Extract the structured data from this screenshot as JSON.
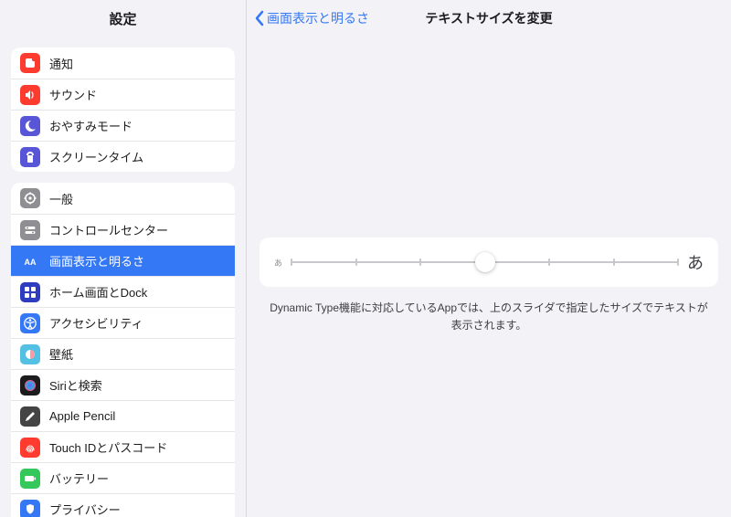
{
  "sidebar": {
    "title": "設定",
    "groups": [
      {
        "items": [
          {
            "key": "notifications",
            "label": "通知"
          },
          {
            "key": "sounds",
            "label": "サウンド"
          },
          {
            "key": "dnd",
            "label": "おやすみモード"
          },
          {
            "key": "screentime",
            "label": "スクリーンタイム"
          }
        ]
      },
      {
        "items": [
          {
            "key": "general",
            "label": "一般"
          },
          {
            "key": "controlcenter",
            "label": "コントロールセンター"
          },
          {
            "key": "display",
            "label": "画面表示と明るさ",
            "selected": true
          },
          {
            "key": "homescreen",
            "label": "ホーム画面とDock"
          },
          {
            "key": "accessibility",
            "label": "アクセシビリティ"
          },
          {
            "key": "wallpaper",
            "label": "壁紙"
          },
          {
            "key": "siri",
            "label": "Siriと検索"
          },
          {
            "key": "pencil",
            "label": "Apple Pencil"
          },
          {
            "key": "touchid",
            "label": "Touch IDとパスコード"
          },
          {
            "key": "battery",
            "label": "バッテリー"
          },
          {
            "key": "privacy",
            "label": "プライバシー"
          }
        ]
      }
    ]
  },
  "main": {
    "back_label": "画面表示と明るさ",
    "title": "テキストサイズを変更",
    "slider": {
      "min_glyph": "あ",
      "max_glyph": "あ",
      "steps": 7,
      "value_index": 3
    },
    "caption": "Dynamic Type機能に対応しているAppでは、上のスライダで指定したサイズでテキストが表示されます。"
  },
  "icons": {
    "notifications": {
      "bg": "#ff3b30"
    },
    "sounds": {
      "bg": "#ff3b30"
    },
    "dnd": {
      "bg": "#5856d6"
    },
    "screentime": {
      "bg": "#5856d6"
    },
    "general": {
      "bg": "#8e8e93"
    },
    "controlcenter": {
      "bg": "#8e8e93"
    },
    "display": {
      "bg": "#3478f6"
    },
    "homescreen": {
      "bg": "#2f3cc0"
    },
    "accessibility": {
      "bg": "#3478f6"
    },
    "wallpaper": {
      "bg": "#54c1e4"
    },
    "siri": {
      "bg": "#1c1c1e"
    },
    "pencil": {
      "bg": "#444444"
    },
    "touchid": {
      "bg": "#ff3b30"
    },
    "battery": {
      "bg": "#34c759"
    },
    "privacy": {
      "bg": "#3478f6"
    }
  }
}
